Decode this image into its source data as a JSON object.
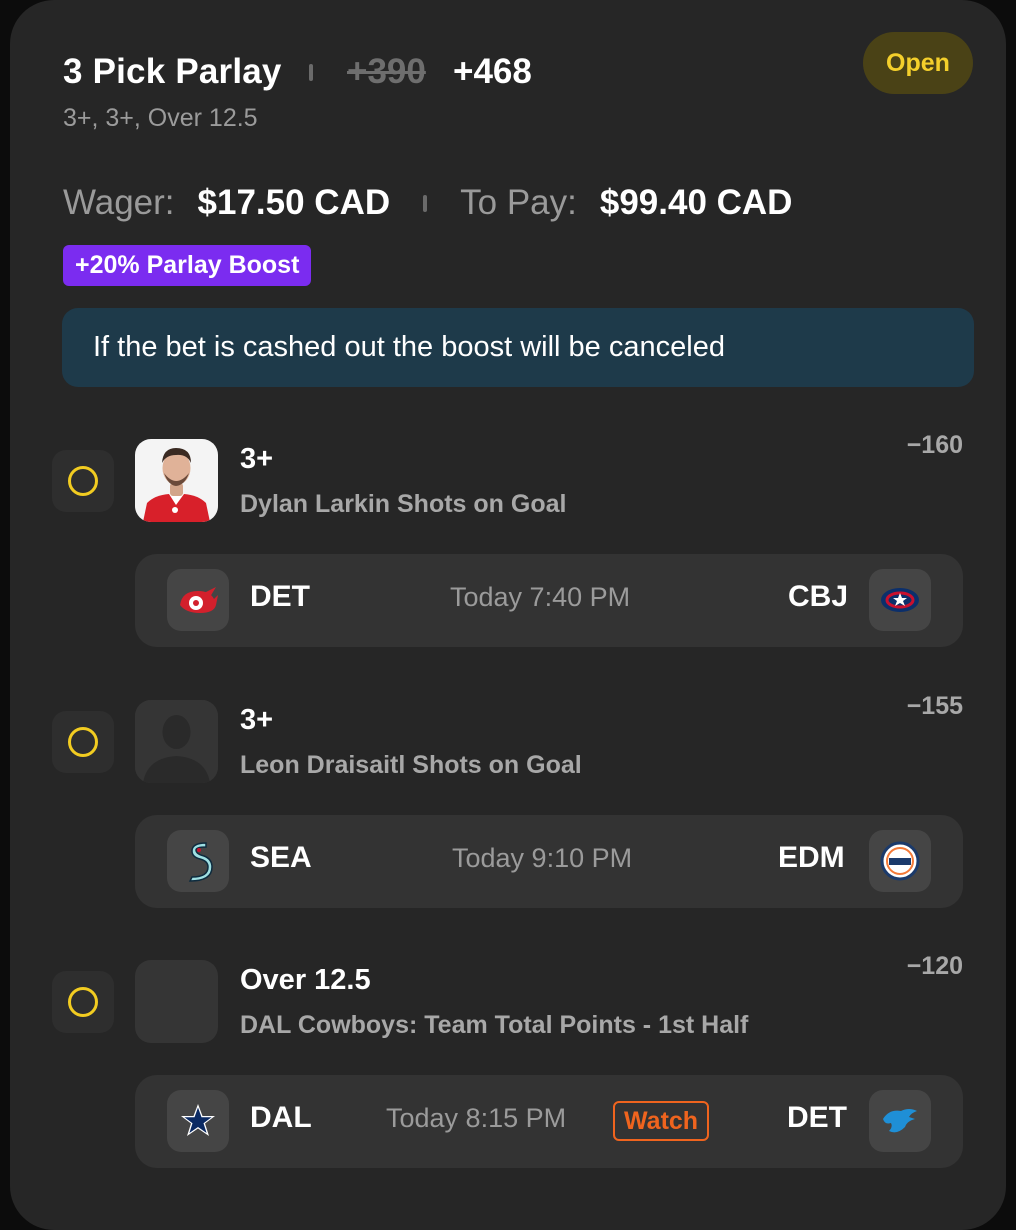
{
  "header": {
    "title": "3 Pick Parlay",
    "original_odds": "+390",
    "boosted_odds": "+468",
    "subtitle": "3+, 3+, Over 12.5",
    "status": "Open"
  },
  "wager": {
    "wager_label": "Wager:",
    "wager_value": "$17.50 CAD",
    "payout_label": "To Pay:",
    "payout_value": "$99.40 CAD"
  },
  "boost_badge": "+20% Parlay Boost",
  "notice": "If the bet is cashed out the boost will be canceled",
  "picks": [
    {
      "line": "3+",
      "market": "Dylan Larkin Shots on Goal",
      "odds": "−160",
      "game": {
        "away": "DET",
        "time": "Today 7:40 PM",
        "home": "CBJ",
        "away_logo": "red-wings-logo-icon",
        "home_logo": "blue-jackets-logo-icon"
      }
    },
    {
      "line": "3+",
      "market": "Leon Draisaitl Shots on Goal",
      "odds": "−155",
      "game": {
        "away": "SEA",
        "time": "Today 9:10 PM",
        "home": "EDM",
        "away_logo": "kraken-logo-icon",
        "home_logo": "oilers-logo-icon"
      }
    },
    {
      "line": "Over 12.5",
      "market": "DAL Cowboys: Team Total Points - 1st Half",
      "odds": "−120",
      "game": {
        "away": "DAL",
        "time": "Today 8:15 PM",
        "watch": "Watch",
        "home": "DET",
        "away_logo": "cowboys-star-logo-icon",
        "home_logo": "lions-logo-icon"
      }
    }
  ],
  "colors": {
    "accent_yellow": "#f2cc21",
    "boost_purple": "#7b2cf0",
    "watch_orange": "#f0641e",
    "notice_bg": "#1e3a4a"
  }
}
